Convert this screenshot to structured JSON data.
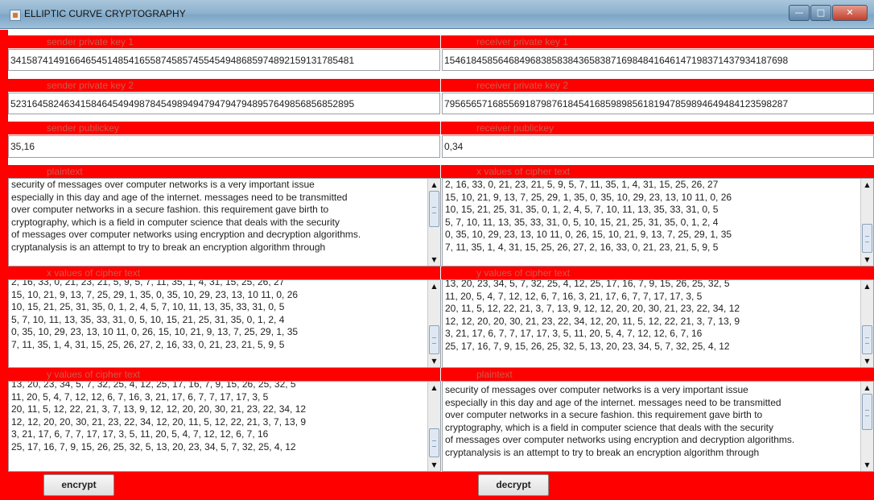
{
  "window": {
    "title": "ELLIPTIC CURVE CRYPTOGRAPHY"
  },
  "labels": {
    "sender_private_key_1": "sender private key 1",
    "receiver_private_key_1": "receiver private key 1",
    "sender_private_key_2": "sender private key 2",
    "receiver_private_key_2": "receiver private key 2",
    "sender_publickey": "sender publickey",
    "receiver_publickey": "receiver publickey",
    "plaintext_left": "plaintext",
    "x_cipher_right": "x values of cipher text",
    "x_cipher_left": "x values of cipher text",
    "y_cipher_right": "y values of cipher text",
    "y_cipher_left": "y values of cipher text",
    "plaintext_right": "plaintext"
  },
  "fields": {
    "sender_private_key_1": "3415874149166465451485416558745857455454948685974892159131785481",
    "receiver_private_key_1": "1546184585646849683858384365838716984841646147198371437934187698",
    "sender_private_key_2": "5231645824634158464549498784549894947947947948957649856856852895",
    "receiver_private_key_2": "7956565716855691879876184541685989856181947859894649484123598287",
    "sender_publickey": "35,16",
    "receiver_publickey": "0,34"
  },
  "areas": {
    "plaintext_input": "security of messages over computer networks is a very important issue\nespecially in this day and age of the internet. messages need to be transmitted\nover computer networks in a secure fashion. this requirement gave birth to\ncryptography, which is a field in computer science that deals with the security\nof messages over computer networks using encryption and decryption algorithms.\ncryptanalysis is an attempt to try to break an encryption algorithm through",
    "x_cipher_top_right": "2, 16, 33, 0, 21, 23, 21, 5, 9, 5, 7, 11, 35, 1, 4, 31, 15, 25, 26, 27\n15, 10, 21, 9, 13, 7, 25, 29, 1, 35, 0, 35, 10, 29, 23, 13, 10 11, 0, 26\n10, 15, 21, 25, 31, 35, 0, 1, 2, 4, 5, 7, 10, 11, 13, 35, 33, 31, 0, 5\n5, 7, 10, 11, 13, 35, 33, 31, 0, 5, 10, 15, 21, 25, 31, 35, 0, 1, 2, 4\n0, 35, 10, 29, 23, 13, 10 11, 0, 26, 15, 10, 21, 9, 13, 7, 25, 29, 1, 35\n7, 11, 35, 1, 4, 31, 15, 25, 26, 27, 2, 16, 33, 0, 21, 23, 21, 5, 9, 5",
    "x_cipher_mid_left": "2, 16, 33, 0, 21, 23, 21, 5, 9, 5, 7, 11, 35, 1, 4, 31, 15, 25, 26, 27\n15, 10, 21, 9, 13, 7, 25, 29, 1, 35, 0, 35, 10, 29, 23, 13, 10 11, 0, 26\n10, 15, 21, 25, 31, 35, 0, 1, 2, 4, 5, 7, 10, 11, 13, 35, 33, 31, 0, 5\n5, 7, 10, 11, 13, 35, 33, 31, 0, 5, 10, 15, 21, 25, 31, 35, 0, 1, 2, 4\n0, 35, 10, 29, 23, 13, 10 11, 0, 26, 15, 10, 21, 9, 13, 7, 25, 29, 1, 35\n7, 11, 35, 1, 4, 31, 15, 25, 26, 27, 2, 16, 33, 0, 21, 23, 21, 5, 9, 5",
    "y_cipher_mid_right": "13, 20, 23, 34, 5, 7, 32, 25, 4, 12, 25, 17, 16, 7, 9, 15, 26, 25, 32, 5\n11, 20, 5, 4, 7, 12, 12, 6, 7, 16, 3, 21, 17, 6, 7, 7, 17, 17, 3, 5\n20, 11, 5, 12, 22, 21, 3, 7, 13, 9, 12, 12, 20, 20, 30, 21, 23, 22, 34, 12\n12, 12, 20, 20, 30, 21, 23, 22, 34, 12, 20, 11, 5, 12, 22, 21, 3, 7, 13, 9\n3, 21, 17, 6, 7, 7, 17, 17, 3, 5, 11, 20, 5, 4, 7, 12, 12, 6, 7, 16\n25, 17, 16, 7, 9, 15, 26, 25, 32, 5, 13, 20, 23, 34, 5, 7, 32, 25, 4, 12",
    "y_cipher_bottom_left": "13, 20, 23, 34, 5, 7, 32, 25, 4, 12, 25, 17, 16, 7, 9, 15, 26, 25, 32, 5\n11, 20, 5, 4, 7, 12, 12, 6, 7, 16, 3, 21, 17, 6, 7, 7, 17, 17, 3, 5\n20, 11, 5, 12, 22, 21, 3, 7, 13, 9, 12, 12, 20, 20, 30, 21, 23, 22, 34, 12\n12, 12, 20, 20, 30, 21, 23, 22, 34, 12, 20, 11, 5, 12, 22, 21, 3, 7, 13, 9\n3, 21, 17, 6, 7, 7, 17, 17, 3, 5, 11, 20, 5, 4, 7, 12, 12, 6, 7, 16\n25, 17, 16, 7, 9, 15, 26, 25, 32, 5, 13, 20, 23, 34, 5, 7, 32, 25, 4, 12",
    "plaintext_output": "security of messages over computer networks is a very important issue\nespecially in this day and age of the internet. messages need to be transmitted\nover computer networks in a secure fashion. this requirement gave birth to\ncryptography, which is a field in computer science that deals with the security\nof messages over computer networks using encryption and decryption algorithms.\ncryptanalysis is an attempt to try to break an encryption algorithm through"
  },
  "buttons": {
    "encrypt": "encrypt",
    "decrypt": "decrypt"
  },
  "colors": {
    "panel_red": "#ff0000",
    "label_text": "#c85b4b",
    "title_bar": "#8eb3cf"
  }
}
